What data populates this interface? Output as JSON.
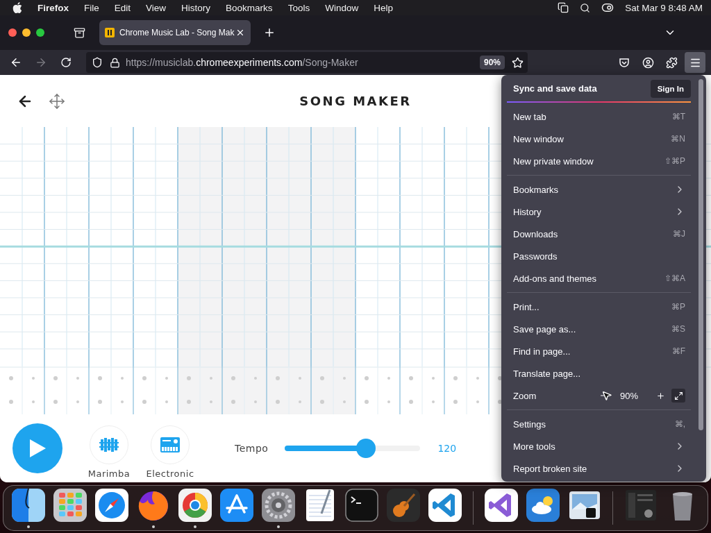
{
  "menu_bar": {
    "app": "Firefox",
    "items": [
      "File",
      "Edit",
      "View",
      "History",
      "Bookmarks",
      "Tools",
      "Window",
      "Help"
    ],
    "clock": "Sat Mar 9  8:48 AM"
  },
  "tabs": [
    {
      "title": "Chrome Music Lab - Song Mak",
      "selected": true
    }
  ],
  "toolbar": {
    "forward_disabled": true,
    "url": {
      "before_domain": "https://musiclab.",
      "domain": "chromeexperiments.com",
      "after_domain": "/Song-Maker"
    },
    "zoom": "90%",
    "menu_open": true
  },
  "page": {
    "title": "SONG MAKER"
  },
  "controls": {
    "instruments": [
      {
        "kind": "marimba",
        "label": "Marimba"
      },
      {
        "kind": "electronic",
        "label": "Electronic"
      }
    ],
    "tempo": {
      "label": "Tempo",
      "level": 0.6,
      "value": "120"
    }
  },
  "app_menu": {
    "sync": {
      "title": "Sync and save data",
      "button": "Sign In"
    },
    "sections": [
      [
        {
          "kind": "shortcut",
          "label": "New tab",
          "shortcut": "⌘T"
        },
        {
          "kind": "shortcut",
          "label": "New window",
          "shortcut": "⌘N"
        },
        {
          "kind": "shortcut",
          "label": "New private window",
          "shortcut": "⇧⌘P"
        }
      ],
      [
        {
          "kind": "submenu",
          "label": "Bookmarks"
        },
        {
          "kind": "submenu",
          "label": "History"
        },
        {
          "kind": "shortcut",
          "label": "Downloads",
          "shortcut": "⌘J"
        },
        {
          "kind": "plain",
          "label": "Passwords"
        },
        {
          "kind": "shortcut",
          "label": "Add-ons and themes",
          "shortcut": "⇧⌘A"
        }
      ],
      [
        {
          "kind": "shortcut",
          "label": "Print...",
          "shortcut": "⌘P"
        },
        {
          "kind": "shortcut",
          "label": "Save page as...",
          "shortcut": "⌘S"
        },
        {
          "kind": "shortcut",
          "label": "Find in page...",
          "shortcut": "⌘F"
        },
        {
          "kind": "plain",
          "label": "Translate page..."
        },
        {
          "kind": "zoom",
          "label": "Zoom",
          "value": "90%"
        }
      ],
      [
        {
          "kind": "shortcut",
          "label": "Settings",
          "shortcut": "⌘,"
        },
        {
          "kind": "submenu",
          "label": "More tools"
        },
        {
          "kind": "submenu",
          "label": "Report broken site"
        }
      ]
    ]
  },
  "dock": {
    "groups": [
      [
        {
          "kind": "finder",
          "running": true
        },
        {
          "kind": "launcher",
          "running": false
        },
        {
          "kind": "compass",
          "running": false
        },
        {
          "kind": "fox",
          "running": true
        },
        {
          "kind": "ring",
          "running": true
        },
        {
          "kind": "pencils",
          "running": false
        },
        {
          "kind": "gear",
          "running": true
        },
        {
          "kind": "notepad",
          "running": false
        },
        {
          "kind": "terminal",
          "running": false
        },
        {
          "kind": "guitar",
          "running": false
        },
        {
          "kind": "ribbon",
          "running": false
        }
      ],
      [
        {
          "kind": "ribbonpurple",
          "running": false
        },
        {
          "kind": "weather",
          "running": false
        },
        {
          "kind": "photo",
          "running": false
        }
      ],
      [
        {
          "kind": "thumbnail",
          "running": false
        },
        {
          "kind": "trash",
          "running": false
        }
      ]
    ]
  }
}
